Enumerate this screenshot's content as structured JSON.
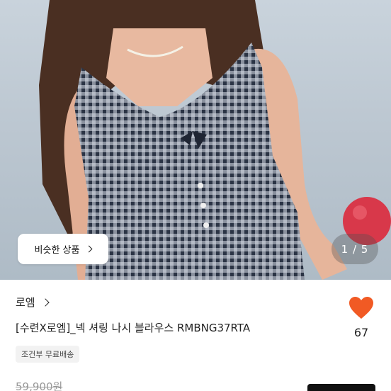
{
  "photo": {
    "similar_button_label": "비슷한 상품",
    "page_indicator": "1 / 5"
  },
  "product": {
    "shop_name": "로엠",
    "title": "[수련X로엠]_넥 셔링 나시 블라우스 RMBNG37RTA",
    "shipping_badge": "조건부 무료배송",
    "original_price": "59,900원",
    "like_count": "67"
  },
  "colors": {
    "like_heart": "#f15a24",
    "buy_button": "#111111",
    "badge_bg": "#f2f2f2"
  }
}
